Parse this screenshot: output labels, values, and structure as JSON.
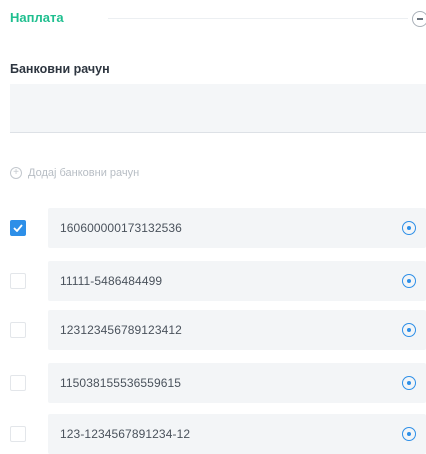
{
  "section": {
    "title": "Наплата"
  },
  "field": {
    "label": "Банковни рачун",
    "value": ""
  },
  "add_link": {
    "label": "Додај банковни рачун"
  },
  "accounts": [
    {
      "number": "160600000173132536",
      "selected": true
    },
    {
      "number": "11111-5486484499",
      "selected": false
    },
    {
      "number": "123123456789123412",
      "selected": false
    },
    {
      "number": "115038155536559615",
      "selected": false
    },
    {
      "number": "123-1234567891234-12",
      "selected": false
    }
  ],
  "colors": {
    "accent_green": "#1fbf8f",
    "accent_blue": "#2d8fe8"
  },
  "icons": {
    "collapse": "minus-circle-icon",
    "add": "plus-circle-icon",
    "row_action": "circle-dot-icon",
    "check": "checkmark-icon"
  }
}
